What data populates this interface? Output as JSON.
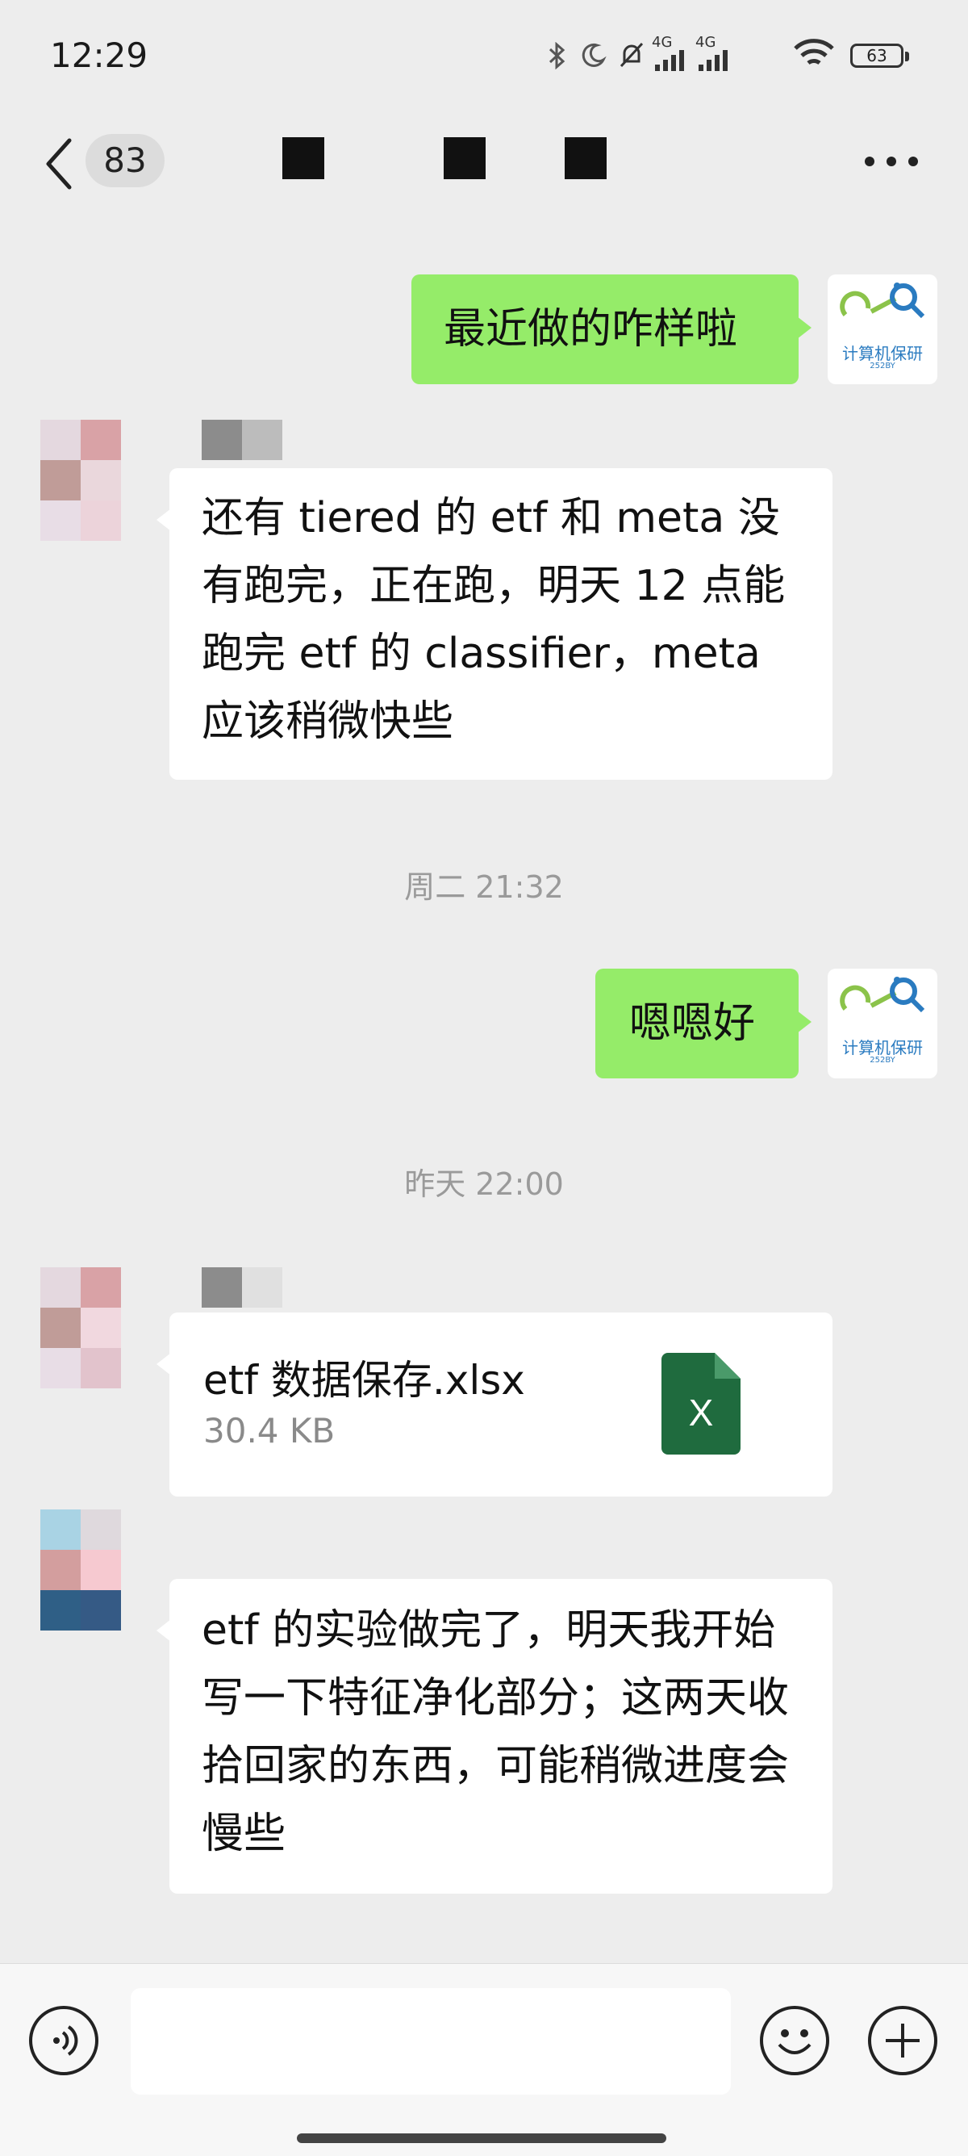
{
  "status_bar": {
    "time": "12:29",
    "network_1": "4G",
    "network_2": "4G",
    "battery_level": "63"
  },
  "nav": {
    "unread_count": "83"
  },
  "messages": [
    {
      "type": "text",
      "side": "right",
      "text": "最近做的咋样啦"
    },
    {
      "type": "text",
      "side": "left",
      "text": "还有 tiered 的 etf 和 meta 没有跑完，正在跑，明天 12 点能跑完 etf 的 classifier，meta 应该稍微快些"
    },
    {
      "type": "timestamp",
      "text": "周二 21:32"
    },
    {
      "type": "text",
      "side": "right",
      "text": "嗯嗯好"
    },
    {
      "type": "timestamp",
      "text": "昨天 22:00"
    },
    {
      "type": "file",
      "side": "left",
      "file_name": "etf 数据保存.xlsx",
      "file_size": "30.4 KB",
      "icon": "excel-icon",
      "icon_letter": "X"
    },
    {
      "type": "text",
      "side": "left",
      "text": "etf 的实验做完了，明天我开始写一下特征净化部分；这两天收拾回家的东西，可能稍微进度会慢些"
    }
  ],
  "my_avatar": {
    "label": "计算机保研",
    "sub": "252BY"
  },
  "input_bar": {
    "value": "",
    "voice_icon": "voice-icon",
    "emoji_icon": "emoji-icon",
    "plus_icon": "plus-icon"
  },
  "colors": {
    "background": "#ededed",
    "my_bubble": "#95ec69",
    "their_bubble": "#ffffff",
    "excel_green": "#1f6b3e",
    "timestamp": "#9a9a9a"
  }
}
